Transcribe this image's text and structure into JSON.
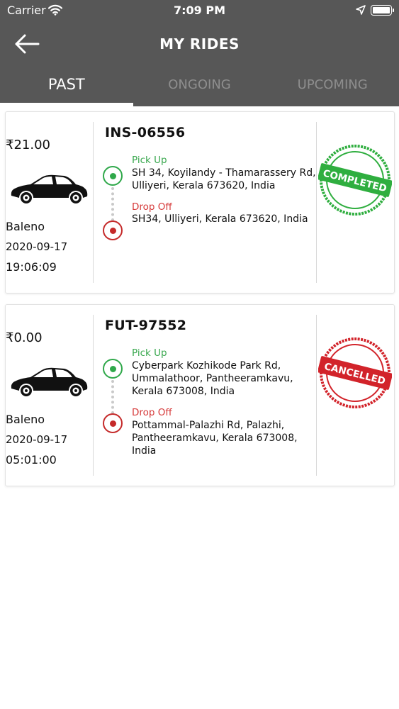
{
  "status_bar": {
    "carrier": "Carrier",
    "time": "7:09 PM"
  },
  "header": {
    "title": "MY RIDES"
  },
  "tabs": [
    {
      "label": "PAST",
      "active": true
    },
    {
      "label": "ONGOING",
      "active": false
    },
    {
      "label": "UPCOMING",
      "active": false
    }
  ],
  "rides": [
    {
      "price": "₹21.00",
      "car": "Baleno",
      "date": "2020-09-17",
      "time": "19:06:09",
      "ride_id": "INS-06556",
      "pickup_label": "Pick Up",
      "pickup_address": "SH 34, Koyilandy - Thamarassery Rd, Ulliyeri, Kerala 673620, India",
      "drop_label": "Drop Off",
      "drop_address": "SH34, Ulliyeri, Kerala 673620, India",
      "status": "COMPLETED",
      "status_color": "#2fae3f"
    },
    {
      "price": "₹0.00",
      "car": "Baleno",
      "date": "2020-09-17",
      "time": "05:01:00",
      "ride_id": "FUT-97552",
      "pickup_label": "Pick Up",
      "pickup_address": "Cyberpark Kozhikode Park Rd, Ummalathoor, Pantheeramkavu, Kerala 673008, India",
      "drop_label": "Drop Off",
      "drop_address": "Pottammal-Palazhi Rd, Palazhi, Pantheeramkavu, Kerala 673008, India",
      "status": "CANCELLED",
      "status_color": "#d2232a"
    }
  ],
  "colors": {
    "header_bg": "#575757",
    "pickup": "#2fa84a",
    "drop": "#c52a2a"
  }
}
